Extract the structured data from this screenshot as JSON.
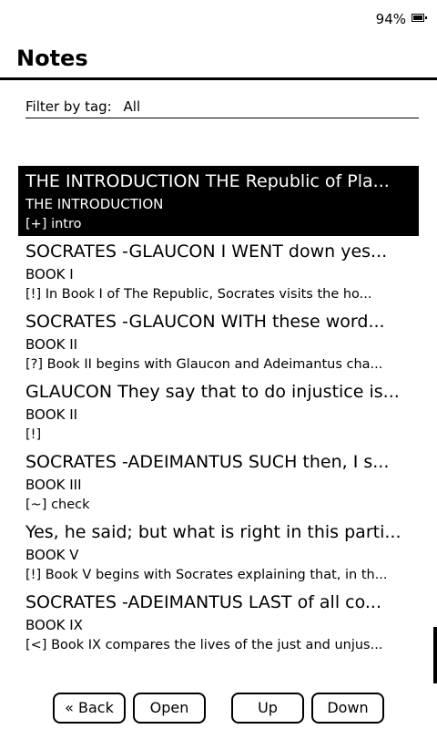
{
  "status": {
    "battery": "94%"
  },
  "header": {
    "title": "Notes"
  },
  "filter": {
    "label": "Filter by tag:",
    "value": "All"
  },
  "notes": [
    {
      "title": "THE INTRODUCTION THE Republic of Pla...",
      "chapter": "THE INTRODUCTION",
      "desc": "[+] intro"
    },
    {
      "title": "SOCRATES -GLAUCON I WENT down yes...",
      "chapter": "BOOK I",
      "desc": "[!] In Book I of The Republic, Socrates visits the ho..."
    },
    {
      "title": "SOCRATES -GLAUCON WITH these word...",
      "chapter": "BOOK II",
      "desc": "[?] Book II begins with Glaucon and Adeimantus cha..."
    },
    {
      "title": "GLAUCON They say that to do injustice is...",
      "chapter": "BOOK II",
      "desc": "[!]"
    },
    {
      "title": "SOCRATES -ADEIMANTUS SUCH then, I s...",
      "chapter": "BOOK III",
      "desc": "[~] check"
    },
    {
      "title": "Yes, he said; but what is right in this parti...",
      "chapter": "BOOK V",
      "desc": "[!] Book V begins with Socrates explaining that, in th..."
    },
    {
      "title": "SOCRATES -ADEIMANTUS LAST of all co...",
      "chapter": "BOOK IX",
      "desc": "[<] Book IX compares the lives of the just and unjus..."
    }
  ],
  "buttons": {
    "back": "« Back",
    "open": "Open",
    "up": "Up",
    "down": "Down"
  }
}
